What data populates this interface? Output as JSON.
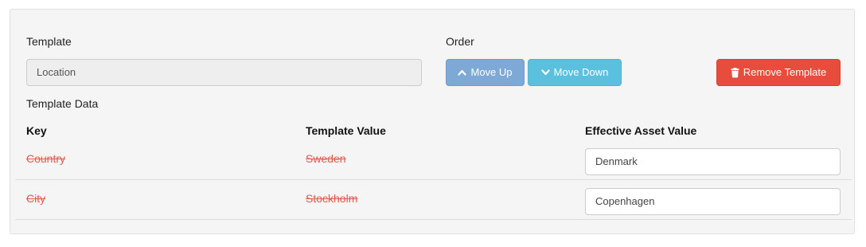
{
  "form": {
    "template_label": "Template",
    "template_value": "Location",
    "order_label": "Order",
    "template_data_label": "Template Data"
  },
  "buttons": {
    "move_up": "Move Up",
    "move_down": "Move Down",
    "remove_template": "Remove Template"
  },
  "table": {
    "headers": {
      "key": "Key",
      "template_value": "Template Value",
      "effective_value": "Effective Asset Value"
    },
    "rows": [
      {
        "key": "Country",
        "template_value": "Sweden",
        "effective_value": "Denmark"
      },
      {
        "key": "City",
        "template_value": "Stockholm",
        "effective_value": "Copenhagen"
      }
    ]
  },
  "icons": {
    "move_up": "chevron-up-icon",
    "move_down": "chevron-down-icon",
    "remove": "trash-icon"
  },
  "colors": {
    "move_up_button": "#7ea9d6",
    "move_down_button": "#5bc0de",
    "remove_button": "#e74c3c",
    "overridden_text": "#e05a4e"
  }
}
